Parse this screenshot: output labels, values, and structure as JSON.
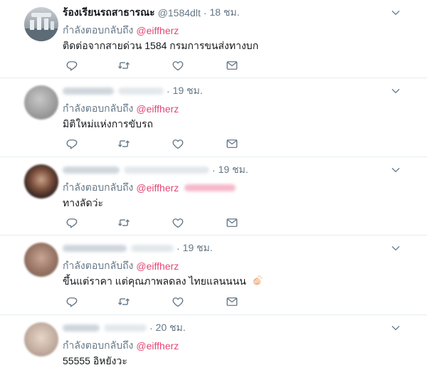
{
  "reply_prefix": "กำลังตอบกลับถึง",
  "colors": {
    "mention": "#e0245e",
    "muted": "#657786",
    "divider": "#e6ecf0"
  },
  "icons": [
    "reply-icon",
    "retweet-icon",
    "like-icon",
    "direct-message-icon",
    "chevron-down-icon"
  ],
  "tweets": [
    {
      "name": "ร้องเรียนรถสาธารณะ",
      "handle": "@1584dlt",
      "time": "18 ชม.",
      "mention": "@eiffherz",
      "text": "ติดต่อจากสายด่วน 1584 กรมการขนส่งทางบก"
    },
    {
      "time": "19 ชม.",
      "mention": "@eiffherz",
      "text": "มิติใหม่แห่งการขับรถ"
    },
    {
      "time": "19 ชม.",
      "mention": "@eiffherz",
      "text": "ทางลัดว่ะ"
    },
    {
      "time": "19 ชม.",
      "mention": "@eiffherz",
      "text": "ขึ้นแต่ราคา แต่คุณภาพลดลง ไทยแลนนนน",
      "emoji": "clapping-hands"
    },
    {
      "time": "20 ชม.",
      "mention": "@eiffherz",
      "text": "55555 อิหยังวะ"
    }
  ]
}
